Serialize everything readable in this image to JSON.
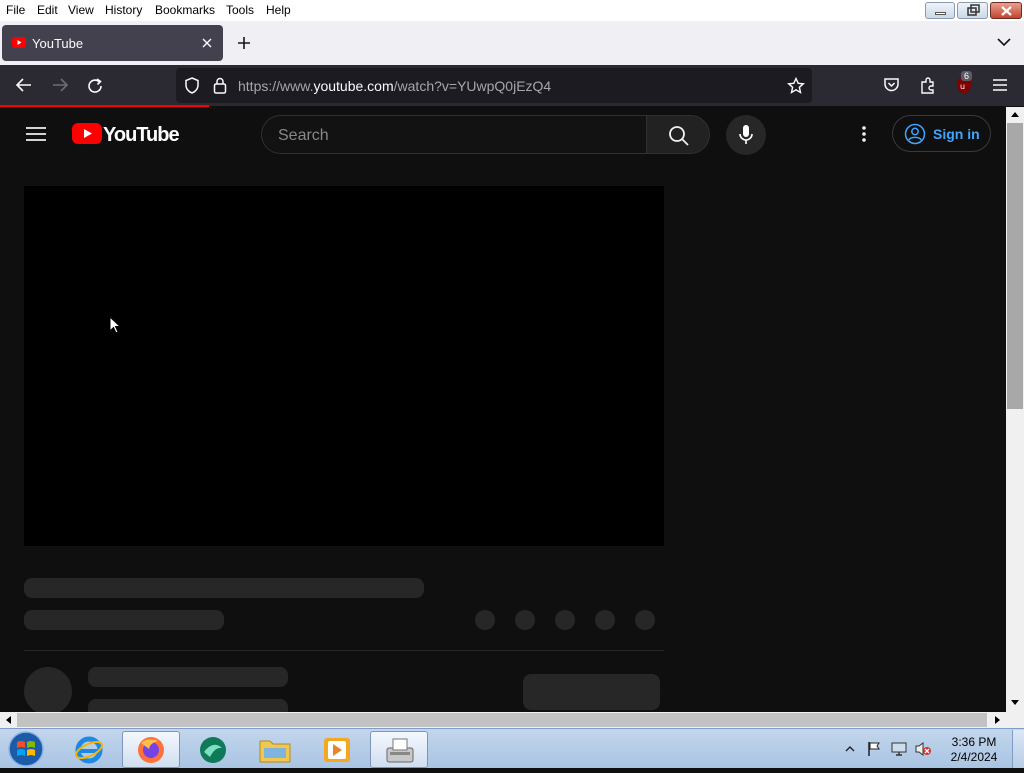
{
  "menu": {
    "items": [
      "File",
      "Edit",
      "View",
      "History",
      "Bookmarks",
      "Tools",
      "Help"
    ],
    "window_controls": [
      "minimize-icon",
      "restore-icon",
      "close-icon"
    ]
  },
  "tabs": [
    {
      "title": "YouTube",
      "icon": "youtube-favicon",
      "active": true
    }
  ],
  "toolbar": {
    "url_prefix": "https://www.",
    "url_domain": "youtube.com",
    "url_path": "/watch?v=YUwpQ0jEzQ4",
    "extension_badge": "6",
    "icons": [
      "back-arrow-icon",
      "forward-arrow-icon",
      "reload-icon",
      "shield-icon",
      "lock-icon",
      "star-icon",
      "pocket-icon",
      "extensions-icon",
      "ublock-icon",
      "hamburger-menu-icon"
    ]
  },
  "youtube": {
    "logo_text": "YouTube",
    "search_placeholder": "Search",
    "signin_label": "Sign in"
  },
  "taskbar": {
    "apps": [
      "windows-start-icon",
      "internet-explorer-icon",
      "firefox-icon",
      "dreamweaver-icon",
      "file-explorer-icon",
      "media-player-icon",
      "fax-icon"
    ],
    "time": "3:36 PM",
    "date": "2/4/2024"
  },
  "colors": {
    "youtube_red": "#ff0000",
    "link_blue": "#3ea6ff",
    "dark_bg": "#0f0f0f"
  }
}
